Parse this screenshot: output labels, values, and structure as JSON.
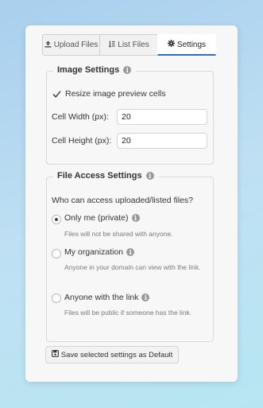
{
  "tabs": [
    {
      "label": "Upload Files",
      "icon": "upload-icon"
    },
    {
      "label": "List Files",
      "icon": "list-icon"
    },
    {
      "label": "Settings",
      "icon": "gear-icon",
      "active": true
    }
  ],
  "image_settings": {
    "legend": "Image Settings",
    "resize_label": "Resize image preview cells",
    "resize_checked": true,
    "cell_width_label": "Cell Width (px):",
    "cell_width_value": "20",
    "cell_height_label": "Cell Height (px):",
    "cell_height_value": "20"
  },
  "file_access": {
    "legend": "File Access Settings",
    "question": "Who can access uploaded/listed files?",
    "options": [
      {
        "label": "Only me (private)",
        "desc": "Files will not be shared with anyone.",
        "selected": true
      },
      {
        "label": "My organization",
        "desc": "Anyone in your domain can view with the link.",
        "selected": false
      },
      {
        "label": "Anyone with the link",
        "desc": "Files will be public if someone has the link.",
        "selected": false
      }
    ]
  },
  "save_button_label": "Save selected settings as Default",
  "colors": {
    "accent": "#2f6fb3",
    "info_icon": "#9a9a9a"
  }
}
